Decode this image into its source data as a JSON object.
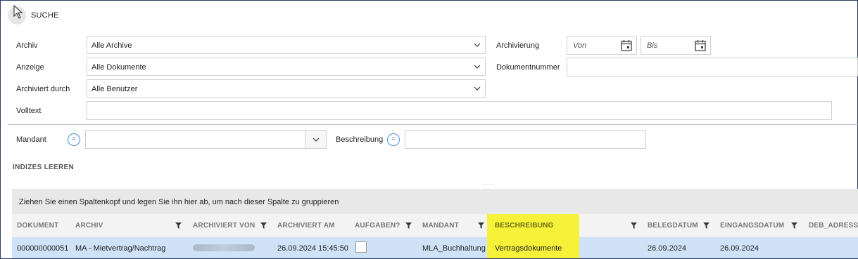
{
  "header": {
    "title": "SUCHE"
  },
  "form": {
    "archiv": {
      "label": "Archiv",
      "value": "Alle Archive"
    },
    "anzeige": {
      "label": "Anzeige",
      "value": "Alle Dokumente"
    },
    "archiviert_durch": {
      "label": "Archiviert durch",
      "value": "Alle Benutzer"
    },
    "volltext": {
      "label": "Volltext",
      "value": ""
    },
    "archivierung": {
      "label": "Archivierung",
      "von": "Von",
      "bis": "Bis"
    },
    "dokumentnummer": {
      "label": "Dokumentnummer",
      "value": ""
    },
    "mandant": {
      "label": "Mandant",
      "value": "",
      "eq": "="
    },
    "beschreibung": {
      "label": "Beschreibung",
      "value": "",
      "eq": "="
    },
    "clear_indices": "INDIZES LEEREN",
    "splitter": "....."
  },
  "grid": {
    "group_hint": "Ziehen Sie einen Spaltenkopf und legen Sie ihn hier ab, um nach dieser Spalte zu gruppieren",
    "columns": [
      "DOKUMENT",
      "ARCHIV",
      "ARCHIVIERT VON",
      "ARCHIVIERT AM",
      "AUFGABEN?",
      "MANDANT",
      "BESCHREIBUNG",
      "BELEGDATUM",
      "EINGANGSDATUM",
      "DEB_ADRESSE"
    ],
    "rows": [
      {
        "dokument": "000000000051",
        "archiv": "MA - Mietvertrag/Nachtrag",
        "archiviert_von": "",
        "archiviert_am": "26.09.2024 15:45:50",
        "aufgaben": false,
        "mandant": "MLA_Buchhaltung",
        "beschreibung": "Vertragsdokumente",
        "belegdatum": "26.09.2024",
        "eingangsdatum": "26.09.2024",
        "deb_adresse": ""
      }
    ],
    "highlight_color": "#f6f23a",
    "selected_row_color": "#cfe2f7"
  },
  "icons": {
    "menu": "cursor-arrow-icon",
    "dropdown": "chevron-down-icon",
    "calendar": "calendar-icon",
    "filter": "filter-icon",
    "equals": "equals-icon"
  }
}
